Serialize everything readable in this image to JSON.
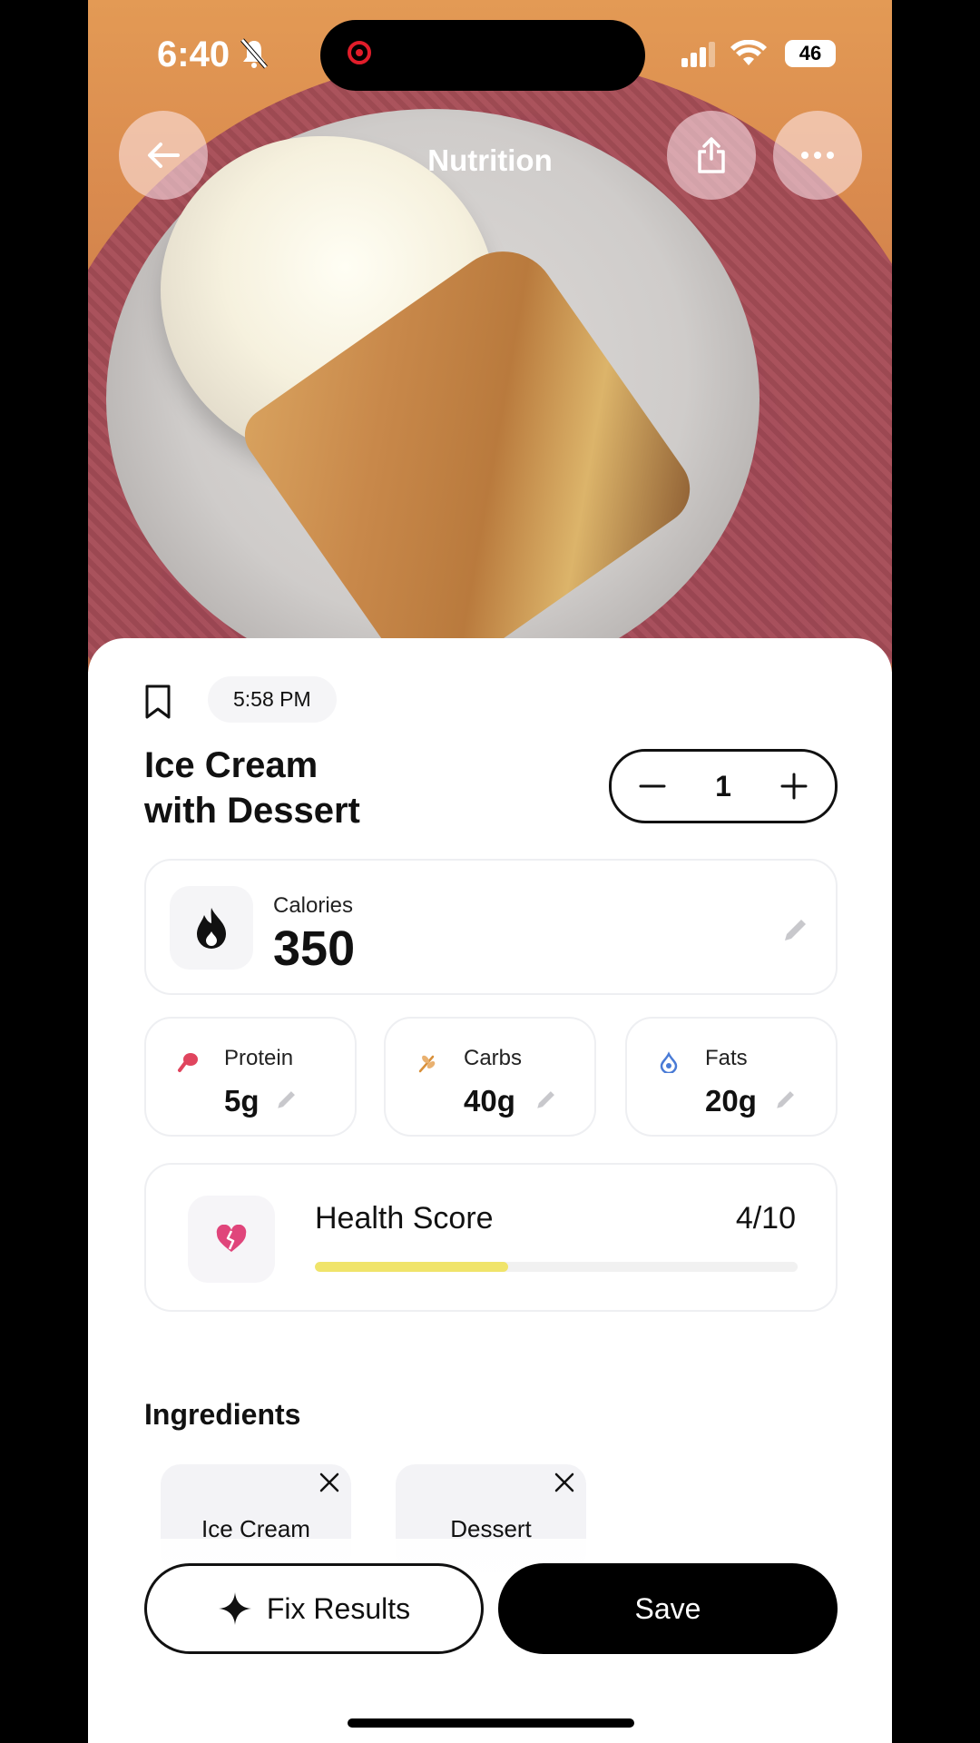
{
  "status_bar": {
    "time": "6:40",
    "battery": "46"
  },
  "header": {
    "title": "Nutrition"
  },
  "entry": {
    "timestamp": "5:58 PM",
    "name_line1": "Ice Cream",
    "name_line2": "with Dessert",
    "quantity": "1"
  },
  "calories": {
    "label": "Calories",
    "value": "350"
  },
  "macros": [
    {
      "label": "Protein",
      "value": "5g"
    },
    {
      "label": "Carbs",
      "value": "40g"
    },
    {
      "label": "Fats",
      "value": "20g"
    }
  ],
  "health": {
    "label": "Health Score",
    "score": "4/10",
    "level": 0.4,
    "bar_color": "#F0E46A"
  },
  "ingredients": {
    "title": "Ingredients",
    "items": [
      "Ice Cream",
      "Dessert"
    ]
  },
  "actions": {
    "fix_label": "Fix Results",
    "save_label": "Save"
  },
  "colors": {
    "protein": "#E0455E",
    "carbs": "#D9903A",
    "fats": "#4A7BD6",
    "health_icon": "#E0457B"
  }
}
